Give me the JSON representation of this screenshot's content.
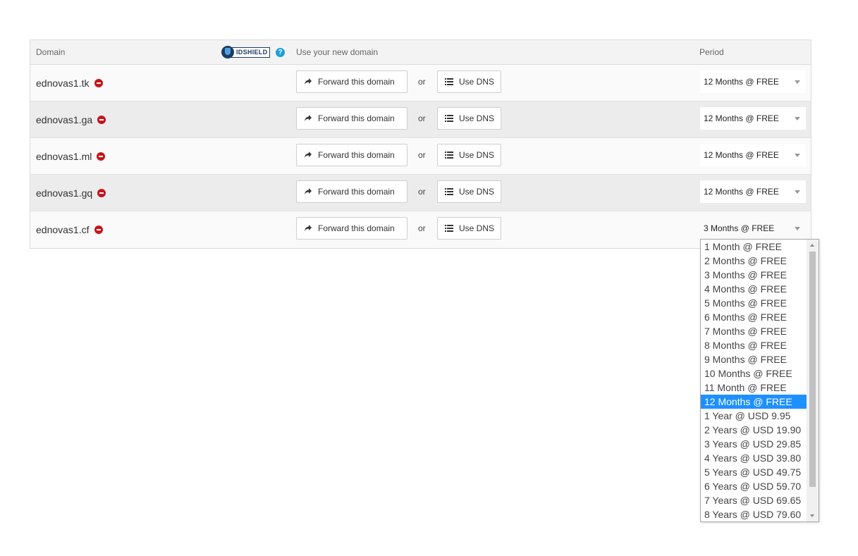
{
  "header": {
    "domain_label": "Domain",
    "use_label": "Use your new domain",
    "period_label": "Period",
    "idshield_logo": "IDSHIELD",
    "help_icon": "?"
  },
  "rows": [
    {
      "domain": "ednovas1.tk",
      "forward_label": "Forward this domain",
      "or": "or",
      "dns_label": "Use DNS",
      "period": "12 Months @ FREE"
    },
    {
      "domain": "ednovas1.ga",
      "forward_label": "Forward this domain",
      "or": "or",
      "dns_label": "Use DNS",
      "period": "12 Months @ FREE"
    },
    {
      "domain": "ednovas1.ml",
      "forward_label": "Forward this domain",
      "or": "or",
      "dns_label": "Use DNS",
      "period": "12 Months @ FREE"
    },
    {
      "domain": "ednovas1.gq",
      "forward_label": "Forward this domain",
      "or": "or",
      "dns_label": "Use DNS",
      "period": "12 Months @ FREE"
    },
    {
      "domain": "ednovas1.cf",
      "forward_label": "Forward this domain",
      "or": "or",
      "dns_label": "Use DNS",
      "period": "3 Months @ FREE"
    }
  ],
  "dropdown": {
    "selected_index": 11,
    "options": [
      "1 Month @ FREE",
      "2 Months @ FREE",
      "3 Months @ FREE",
      "4 Months @ FREE",
      "5 Months @ FREE",
      "6 Months @ FREE",
      "7 Months @ FREE",
      "8 Months @ FREE",
      "9 Months @ FREE",
      "10 Months @ FREE",
      "11 Month @ FREE",
      "12 Months @ FREE",
      "1 Year @ USD 9.95",
      "2 Years @ USD 19.90",
      "3 Years @ USD 29.85",
      "4 Years @ USD 39.80",
      "5 Years @ USD 49.75",
      "6 Years @ USD 59.70",
      "7 Years @ USD 69.65",
      "8 Years @ USD 79.60"
    ]
  },
  "colors": {
    "selected_option": "#1e90ff",
    "remove_icon": "#c4161c",
    "help_icon": "#1aa0dc"
  }
}
